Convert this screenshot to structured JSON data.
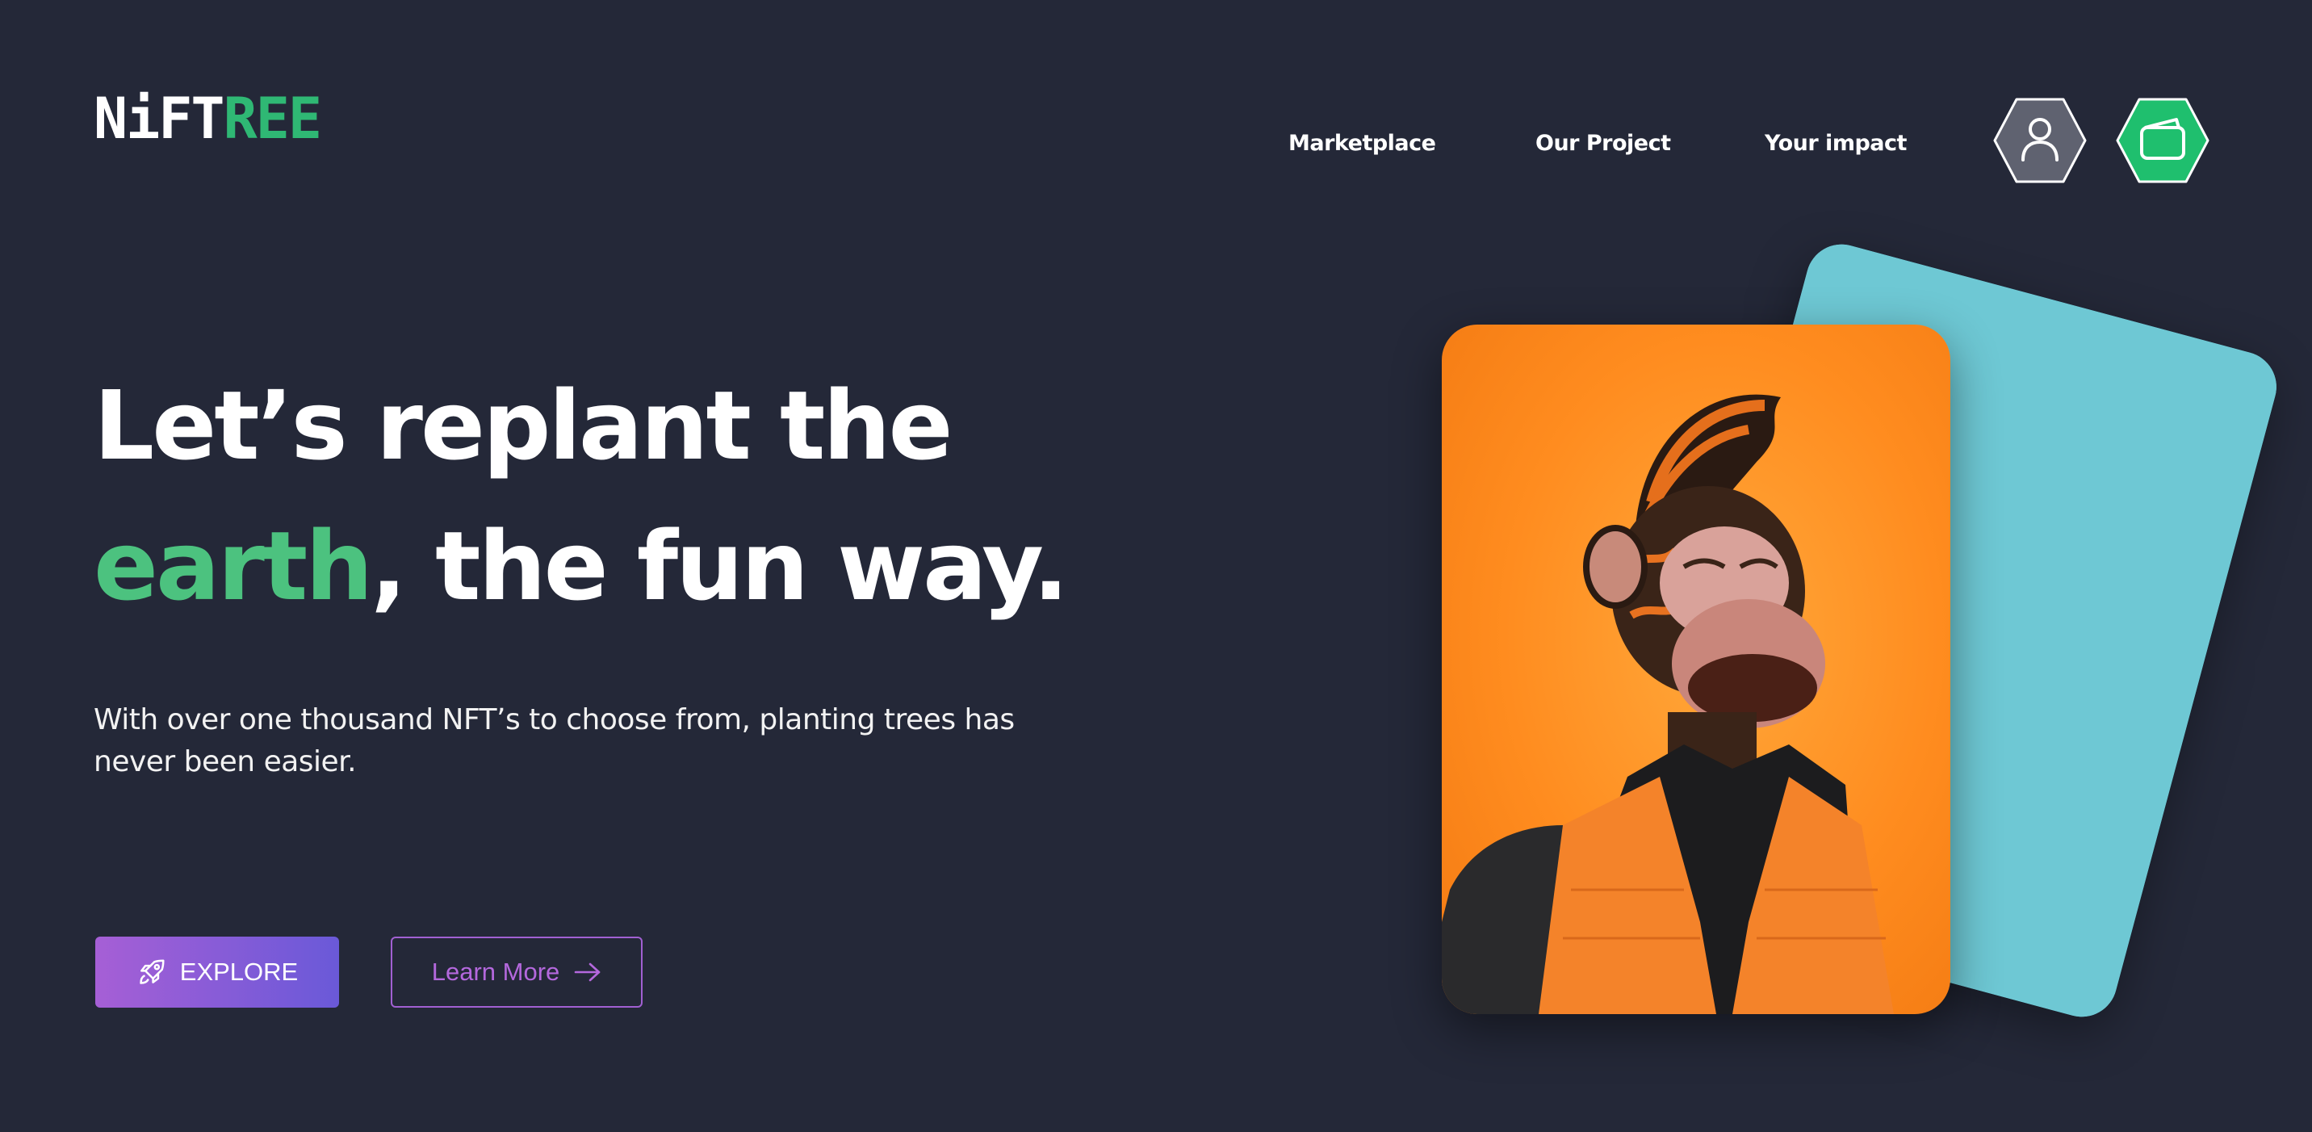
{
  "brand": {
    "logo_white": "NiFT",
    "logo_green": "REE"
  },
  "nav": {
    "items": [
      {
        "label": "Marketplace"
      },
      {
        "label": "Our Project"
      },
      {
        "label": "Your impact"
      }
    ]
  },
  "header_icons": {
    "user": {
      "icon": "user-icon",
      "color": "#5f6270"
    },
    "wallet": {
      "icon": "wallet-icon",
      "color": "#1fbf6e"
    }
  },
  "hero": {
    "title_line1": "Let’s replant the",
    "title_accent": "earth",
    "title_line2_rest": ", the fun way.",
    "subtitle": "With over one thousand NFT’s to choose from, planting trees has never been easier.",
    "explore_label": "EXPLORE",
    "learn_more_label": "Learn More"
  },
  "colors": {
    "background": "#242838",
    "accent_green": "#4cc27f",
    "button_gradient_start": "#a65fd6",
    "button_gradient_end": "#6a59d8",
    "card_front": "#ff8c1f",
    "card_back": "#6ec8d4"
  }
}
